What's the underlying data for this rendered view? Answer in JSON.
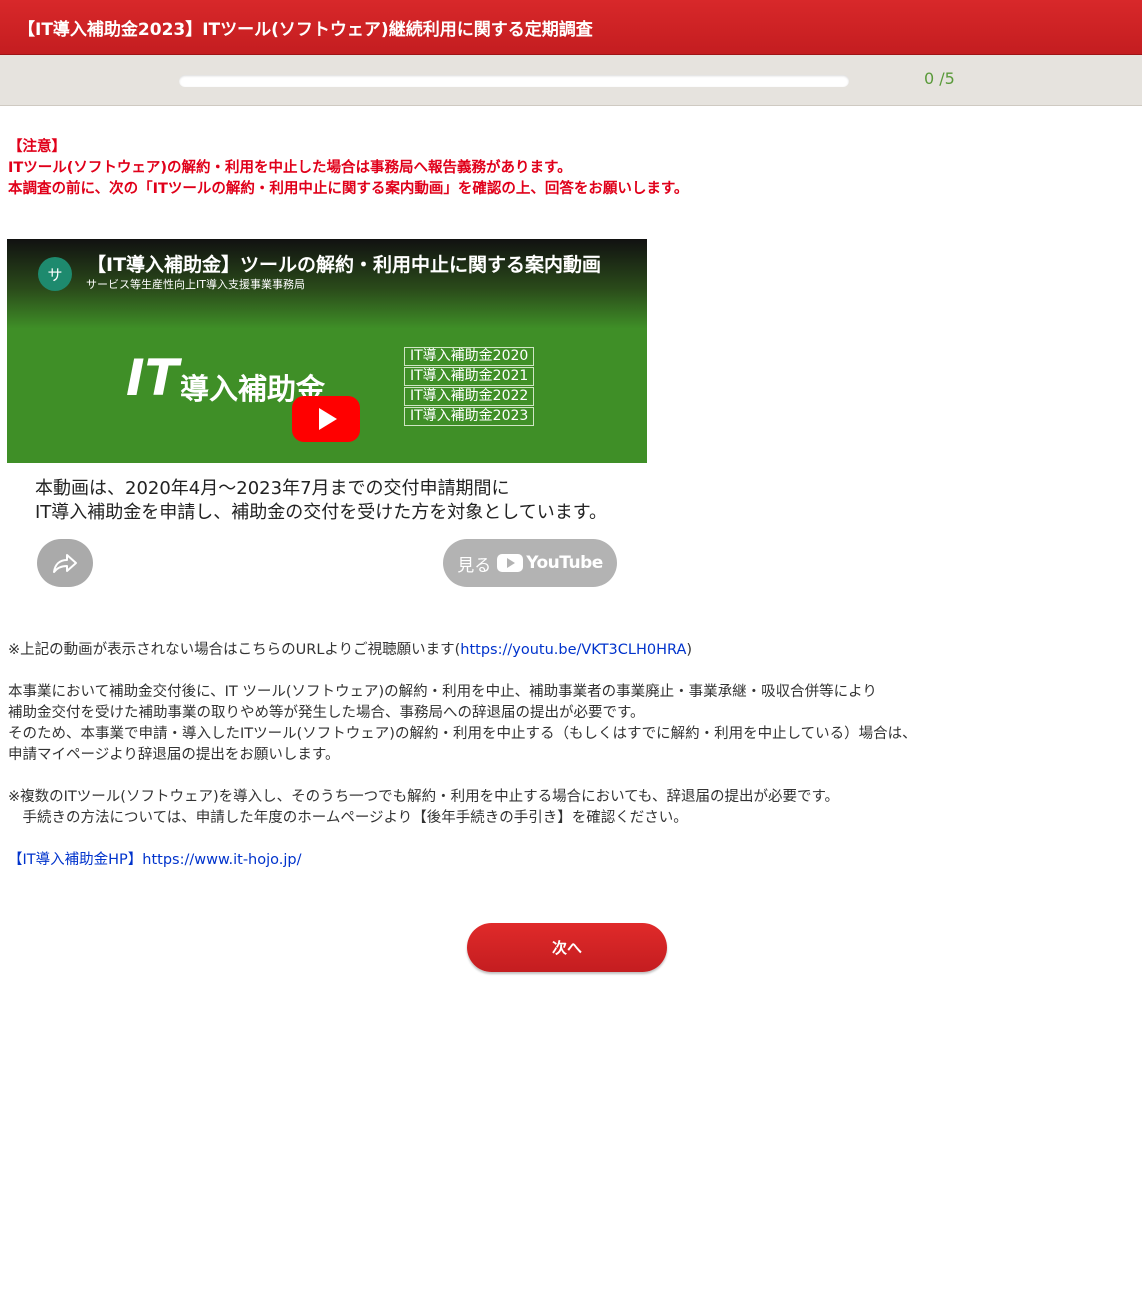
{
  "header": {
    "title": "【IT導入補助金2023】ITツール(ソフトウェア)継続利用に関する定期調査"
  },
  "progress": {
    "text": "0 /5",
    "value": 0,
    "total": 5
  },
  "notice": {
    "label": "【注意】",
    "line1": "ITツール(ソフトウェア)の解約・利用を中止した場合は事務局へ報告義務があります。",
    "line2": "本調査の前に、次の「ITツールの解約・利用中止に関する案内動画」を確認の上、回答をお願いします。"
  },
  "video": {
    "channel_initial": "サ",
    "title": "【IT導入補助金】ツールの解約・利用中止に関する案内動画",
    "channel": "サービス等生産性向上IT導入支援事業事務局",
    "logo_it": "IT",
    "logo_sub": "導入補助金",
    "years": [
      "IT導入補助金2020",
      "IT導入補助金2021",
      "IT導入補助金2022",
      "IT導入補助金2023"
    ],
    "caption_line1": "本動画は、2020年4月～2023年7月までの交付申請期間に",
    "caption_line2": "IT導入補助金を申請し、補助金の交付を受けた方を対象としています。",
    "watch_label": "見る",
    "youtube_label": "YouTube"
  },
  "body": {
    "url_note_prefix": "※上記の動画が表示されない場合はこちらのURLよりご視聴願います(",
    "url_link": "https://youtu.be/VKT3CLH0HRA",
    "url_note_suffix": ")",
    "para1_l1": "本事業において補助金交付後に、IT ツール(ソフトウェア)の解約・利用を中止、補助事業者の事業廃止・事業承継・吸収合併等により",
    "para1_l2": "補助金交付を受けた補助事業の取りやめ等が発生した場合、事務局への辞退届の提出が必要です。",
    "para1_l3": "そのため、本事業で申請・導入したITツール(ソフトウェア)の解約・利用を中止する（もしくはすでに解約・利用を中止している）場合は、",
    "para1_l4": "申請マイページより辞退届の提出をお願いします。",
    "para2_l1": "※複数のITツール(ソフトウェア)を導入し、そのうち一つでも解約・利用を中止する場合においても、辞退届の提出が必要です。",
    "para2_l2": "　手続きの方法については、申請した年度のホームページより【後年手続きの手引き】を確認ください。",
    "hp_link": "【IT導入補助金HP】https://www.it-hojo.jp/"
  },
  "next_button": "次へ"
}
